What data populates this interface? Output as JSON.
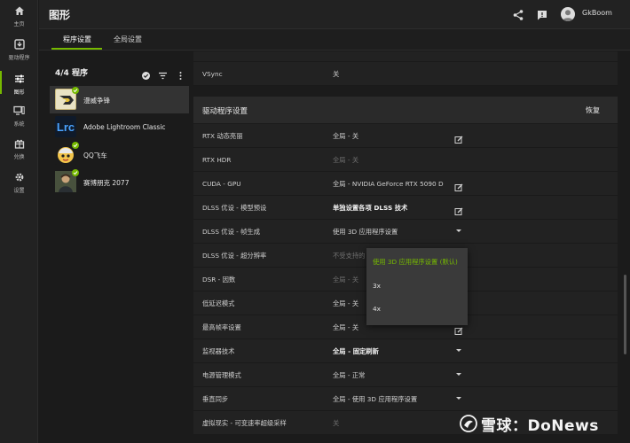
{
  "app": {
    "title": "图形"
  },
  "sidebar": {
    "items": [
      {
        "label": "主页",
        "icon": "home-icon"
      },
      {
        "label": "驱动程序",
        "icon": "driver-icon"
      },
      {
        "label": "图形",
        "icon": "sliders-icon"
      },
      {
        "label": "系统",
        "icon": "monitor-icon"
      },
      {
        "label": "兑换",
        "icon": "gift-icon"
      },
      {
        "label": "设置",
        "icon": "gear-icon"
      }
    ]
  },
  "header": {
    "user_name": "GkBoom"
  },
  "tabs": [
    {
      "label": "程序设置"
    },
    {
      "label": "全局设置"
    }
  ],
  "programs": {
    "title": "4/4 程序",
    "items": [
      {
        "name": "漫威争锋"
      },
      {
        "name": "Adobe Lightroom Classic",
        "icon_text": "Lrc"
      },
      {
        "name": "QQ飞车"
      },
      {
        "name": "赛博朋克 2077"
      }
    ]
  },
  "settings": {
    "top_rows": [
      {
        "label": "VSync",
        "value": "关"
      }
    ],
    "section_title": "驱动程序设置",
    "restore_label": "恢复",
    "rows": [
      {
        "label": "RTX 动态亮丽",
        "value": "全局 - 关",
        "style": "normal",
        "control": "edit"
      },
      {
        "label": "RTX HDR",
        "value": "全局 - 关",
        "style": "dim",
        "control": "none"
      },
      {
        "label": "CUDA - GPU",
        "value": "全局 - NVIDIA GeForce RTX 5090 D",
        "style": "normal",
        "control": "edit"
      },
      {
        "label": "DLSS 优设 - 模型预设",
        "value": "单独设置各项 DLSS 技术",
        "style": "bold",
        "control": "edit"
      },
      {
        "label": "DLSS 优设 - 帧生成",
        "value": "使用 3D 应用程序设置",
        "style": "normal",
        "control": "chevron"
      },
      {
        "label": "DLSS 优设 - 超分辨率",
        "value": "不受支持的",
        "style": "dim",
        "control": "none"
      },
      {
        "label": "DSR - 因数",
        "value": "全局 - 关",
        "style": "dim",
        "control": "none"
      },
      {
        "label": "低延迟模式",
        "value": "全局 - 关",
        "style": "normal",
        "control": "none"
      },
      {
        "label": "最高帧率设置",
        "value": "全局 - 关",
        "style": "normal",
        "control": "edit"
      },
      {
        "label": "监视器技术",
        "value": "全局 - 固定刷新",
        "style": "bold",
        "control": "chevron"
      },
      {
        "label": "电源管理模式",
        "value": "全局 - 正常",
        "style": "normal",
        "control": "chevron"
      },
      {
        "label": "垂直同步",
        "value": "全局 - 使用 3D 应用程序设置",
        "style": "normal",
        "control": "chevron"
      },
      {
        "label": "虚拟现实 - 可变速率超级采样",
        "value": "关",
        "style": "dim",
        "control": "none"
      }
    ]
  },
  "dropdown": {
    "options": [
      {
        "label": "使用 3D 应用程序设置 (默认)",
        "selected": true
      },
      {
        "label": "3x",
        "selected": false
      },
      {
        "label": "4x",
        "selected": false
      }
    ]
  },
  "watermark": {
    "text": "雪球：DoNews"
  },
  "colors": {
    "accent": "#76b900",
    "background": "#1b1b1b",
    "panel": "#222222"
  }
}
